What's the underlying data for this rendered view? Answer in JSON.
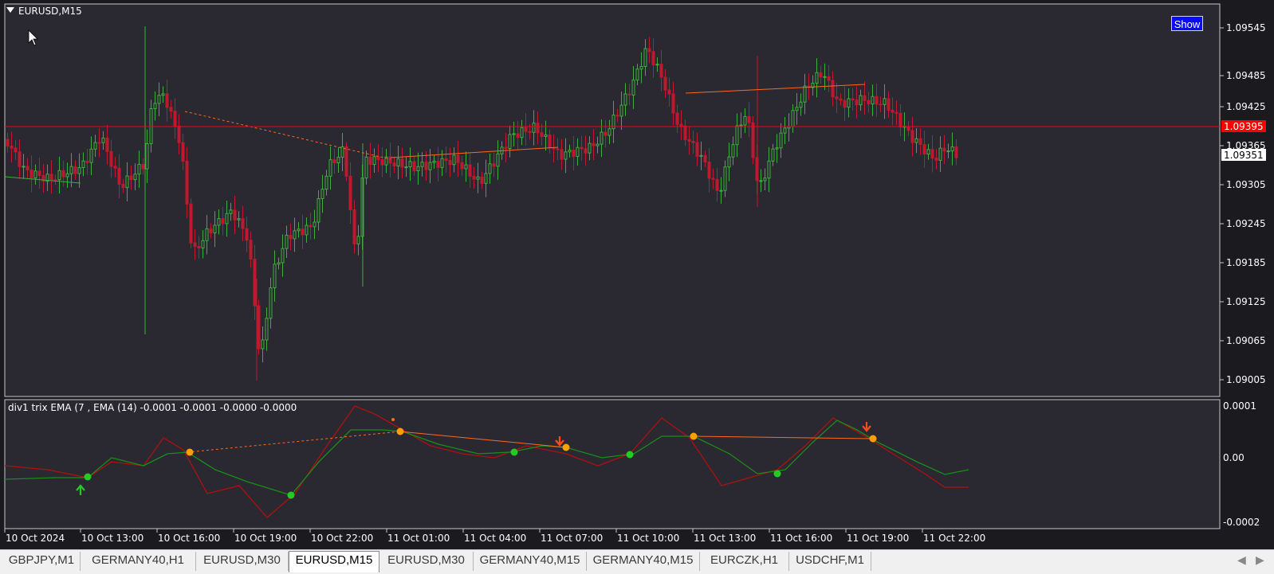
{
  "chart_title": "EURUSD,M15",
  "show_button": "Show",
  "indicator_title": "div1 trix EMA (7 , EMA (14) -0.0001 -0.0001 -0.0000 -0.0000",
  "price_axis": [
    "1.09545",
    "1.09485",
    "1.09425",
    "1.09365",
    "1.09305",
    "1.09245",
    "1.09185",
    "1.09125",
    "1.09065",
    "1.09005"
  ],
  "price_line": {
    "label": "1.09395",
    "color": "#ff0000"
  },
  "bid_label": "1.09351",
  "indicator_axis": [
    "0.0001",
    "0.00",
    "-0.0002"
  ],
  "time_axis": [
    "10 Oct 2024",
    "10 Oct 13:00",
    "10 Oct 16:00",
    "10 Oct 19:00",
    "10 Oct 22:00",
    "11 Oct 01:00",
    "11 Oct 04:00",
    "11 Oct 07:00",
    "11 Oct 10:00",
    "11 Oct 13:00",
    "11 Oct 16:00",
    "11 Oct 19:00",
    "11 Oct 22:00"
  ],
  "colors": {
    "bull": "#3fae3f",
    "bear": "#c0182e",
    "background": "#2a2830",
    "grid_frame": "#c8c8c8",
    "trix_fast": "#1a8c1a",
    "trix_slow": "#b01010",
    "signal_dot_orange": "#ffa000",
    "signal_dot_green": "#22cc22",
    "divergence_line": "#ff6a1a"
  },
  "tabs": [
    {
      "label": "GBPJPY,M1"
    },
    {
      "label": "GERMANY40,H1"
    },
    {
      "label": "EURUSD,M30"
    },
    {
      "label": "EURUSD,M15",
      "active": true
    },
    {
      "label": "EURUSD,M30"
    },
    {
      "label": "GERMANY40,M15"
    },
    {
      "label": "GERMANY40,M15"
    },
    {
      "label": "EURCZK,H1"
    },
    {
      "label": "USDCHF,M1"
    }
  ],
  "icons": {
    "collapse": "triangle-down-icon",
    "cursor": "mouse-pointer-icon",
    "scroll_left": "arrow-left-icon",
    "scroll_right": "arrow-right-icon"
  },
  "chart_data": [
    {
      "type": "candlestick",
      "title": "EURUSD,M15",
      "ylim": [
        1.09,
        1.0957
      ],
      "x": [
        "10 Oct 2024",
        "10 Oct 13:00",
        "10 Oct 16:00",
        "10 Oct 19:00",
        "10 Oct 22:00",
        "11 Oct 01:00",
        "11 Oct 04:00",
        "11 Oct 07:00",
        "11 Oct 10:00",
        "11 Oct 13:00",
        "11 Oct 16:00",
        "11 Oct 19:00",
        "11 Oct 22:00"
      ],
      "series": [
        {
          "name": "close",
          "values": [
            1.0934,
            1.0933,
            1.0936,
            1.0922,
            1.0934,
            1.0934,
            1.0934,
            1.0934,
            1.0943,
            1.0932,
            1.0938,
            1.0943,
            1.0935
          ]
        }
      ],
      "horizontal_line": 1.09395
    },
    {
      "type": "line",
      "ylim": [
        -0.0002,
        0.0001
      ],
      "series": [
        {
          "name": "fast",
          "values": [
            -2e-05,
            -3e-05,
            3e-05,
            -6e-05,
            0.0001,
            1e-05,
            3e-05,
            -1e-05,
            8e-05,
            -3e-05,
            7e-05,
            4e-05,
            -2e-05
          ]
        },
        {
          "name": "slow",
          "values": [
            -3e-05,
            -3e-05,
            1e-05,
            -7e-05,
            4e-05,
            2e-05,
            2e-05,
            1e-05,
            4e-05,
            0.0,
            3e-05,
            4e-05,
            -3e-05
          ]
        }
      ]
    }
  ]
}
